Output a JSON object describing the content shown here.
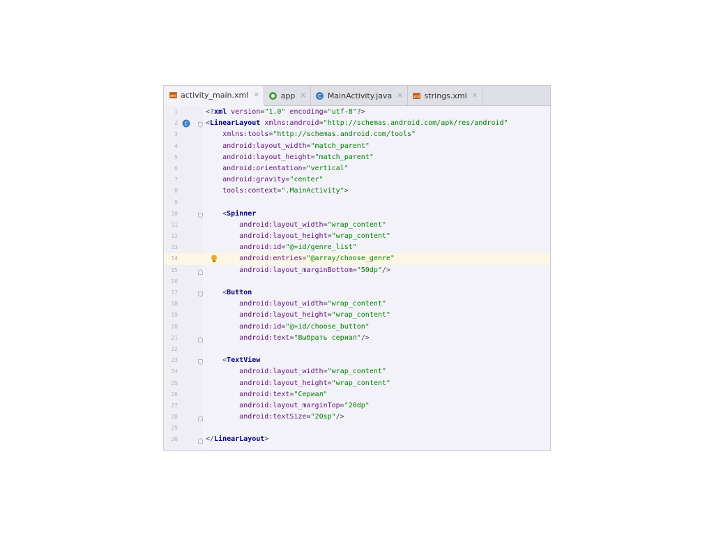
{
  "tabs": [
    {
      "label": "activity_main.xml",
      "icon": "xml-file-icon",
      "active": true
    },
    {
      "label": "app",
      "icon": "android-module-icon",
      "active": false
    },
    {
      "label": "MainActivity.java",
      "icon": "java-class-icon",
      "active": false
    },
    {
      "label": "strings.xml",
      "icon": "xml-file-icon",
      "active": false
    }
  ],
  "lines": [
    {
      "n": "1",
      "parts": [
        [
          "p",
          "<?"
        ],
        [
          "k",
          "xml "
        ],
        [
          "a",
          "version"
        ],
        [
          "p",
          "="
        ],
        [
          "v",
          "\"1.0\" "
        ],
        [
          "a",
          "encoding"
        ],
        [
          "p",
          "="
        ],
        [
          "v",
          "\"utf-8\""
        ],
        [
          "p",
          "?>"
        ]
      ]
    },
    {
      "n": "2",
      "marker": "c",
      "fold": "open",
      "parts": [
        [
          "p",
          "<"
        ],
        [
          "k",
          "LinearLayout "
        ],
        [
          "a",
          "xmlns:android"
        ],
        [
          "p",
          "="
        ],
        [
          "v",
          "\"http://schemas.android.com/apk/res/android\""
        ]
      ]
    },
    {
      "n": "3",
      "parts": [
        [
          "p",
          "    "
        ],
        [
          "a",
          "xmlns:tools"
        ],
        [
          "p",
          "="
        ],
        [
          "v",
          "\"http://schemas.android.com/tools\""
        ]
      ]
    },
    {
      "n": "4",
      "parts": [
        [
          "p",
          "    "
        ],
        [
          "a",
          "android:layout_width"
        ],
        [
          "p",
          "="
        ],
        [
          "v",
          "\"match_parent\""
        ]
      ]
    },
    {
      "n": "5",
      "parts": [
        [
          "p",
          "    "
        ],
        [
          "a",
          "android:layout_height"
        ],
        [
          "p",
          "="
        ],
        [
          "v",
          "\"match_parent\""
        ]
      ]
    },
    {
      "n": "6",
      "parts": [
        [
          "p",
          "    "
        ],
        [
          "a",
          "android:orientation"
        ],
        [
          "p",
          "="
        ],
        [
          "v",
          "\"vertical\""
        ]
      ]
    },
    {
      "n": "7",
      "parts": [
        [
          "p",
          "    "
        ],
        [
          "a",
          "android:gravity"
        ],
        [
          "p",
          "="
        ],
        [
          "v",
          "\"center\""
        ]
      ]
    },
    {
      "n": "8",
      "parts": [
        [
          "p",
          "    "
        ],
        [
          "a",
          "tools:context"
        ],
        [
          "p",
          "="
        ],
        [
          "v",
          "\".MainActivity\""
        ],
        [
          "p",
          ">"
        ]
      ]
    },
    {
      "n": "9",
      "parts": []
    },
    {
      "n": "10",
      "fold": "open",
      "parts": [
        [
          "p",
          "    <"
        ],
        [
          "k",
          "Spinner"
        ]
      ]
    },
    {
      "n": "11",
      "parts": [
        [
          "p",
          "        "
        ],
        [
          "a",
          "android:layout_width"
        ],
        [
          "p",
          "="
        ],
        [
          "v",
          "\"wrap_content\""
        ]
      ]
    },
    {
      "n": "12",
      "parts": [
        [
          "p",
          "        "
        ],
        [
          "a",
          "android:layout_height"
        ],
        [
          "p",
          "="
        ],
        [
          "v",
          "\"wrap_content\""
        ]
      ]
    },
    {
      "n": "13",
      "parts": [
        [
          "p",
          "        "
        ],
        [
          "a",
          "android:id"
        ],
        [
          "p",
          "="
        ],
        [
          "v",
          "\"@+id/genre_list\""
        ]
      ]
    },
    {
      "n": "14",
      "highlight": true,
      "bulb": true,
      "parts": [
        [
          "p",
          "        "
        ],
        [
          "a",
          "android:entries"
        ],
        [
          "p",
          "="
        ],
        [
          "v",
          "\"@array/choose_genre\""
        ]
      ]
    },
    {
      "n": "15",
      "fold": "close",
      "parts": [
        [
          "p",
          "        "
        ],
        [
          "a",
          "android:layout_marginBottom"
        ],
        [
          "p",
          "="
        ],
        [
          "v",
          "\"50dp\""
        ],
        [
          "p",
          "/>"
        ]
      ]
    },
    {
      "n": "16",
      "parts": []
    },
    {
      "n": "17",
      "fold": "open",
      "parts": [
        [
          "p",
          "    <"
        ],
        [
          "k",
          "Button"
        ]
      ]
    },
    {
      "n": "18",
      "parts": [
        [
          "p",
          "        "
        ],
        [
          "a",
          "android:layout_width"
        ],
        [
          "p",
          "="
        ],
        [
          "v",
          "\"wrap_content\""
        ]
      ]
    },
    {
      "n": "19",
      "parts": [
        [
          "p",
          "        "
        ],
        [
          "a",
          "android:layout_height"
        ],
        [
          "p",
          "="
        ],
        [
          "v",
          "\"wrap_content\""
        ]
      ]
    },
    {
      "n": "20",
      "parts": [
        [
          "p",
          "        "
        ],
        [
          "a",
          "android:id"
        ],
        [
          "p",
          "="
        ],
        [
          "v",
          "\"@+id/choose_button\""
        ]
      ]
    },
    {
      "n": "21",
      "fold": "close",
      "parts": [
        [
          "p",
          "        "
        ],
        [
          "a",
          "android:text"
        ],
        [
          "p",
          "="
        ],
        [
          "v",
          "\"Выбрать сериал\""
        ],
        [
          "p",
          "/>"
        ]
      ]
    },
    {
      "n": "22",
      "parts": []
    },
    {
      "n": "23",
      "fold": "open",
      "parts": [
        [
          "p",
          "    <"
        ],
        [
          "k",
          "TextView"
        ]
      ]
    },
    {
      "n": "24",
      "parts": [
        [
          "p",
          "        "
        ],
        [
          "a",
          "android:layout_width"
        ],
        [
          "p",
          "="
        ],
        [
          "v",
          "\"wrap_content\""
        ]
      ]
    },
    {
      "n": "25",
      "parts": [
        [
          "p",
          "        "
        ],
        [
          "a",
          "android:layout_height"
        ],
        [
          "p",
          "="
        ],
        [
          "v",
          "\"wrap_content\""
        ]
      ]
    },
    {
      "n": "26",
      "parts": [
        [
          "p",
          "        "
        ],
        [
          "a",
          "android:text"
        ],
        [
          "p",
          "="
        ],
        [
          "v",
          "\"Сериал\""
        ]
      ]
    },
    {
      "n": "27",
      "parts": [
        [
          "p",
          "        "
        ],
        [
          "a",
          "android:layout_marginTop"
        ],
        [
          "p",
          "="
        ],
        [
          "v",
          "\"20dp\""
        ]
      ]
    },
    {
      "n": "28",
      "fold": "close",
      "parts": [
        [
          "p",
          "        "
        ],
        [
          "a",
          "android:textSize"
        ],
        [
          "p",
          "="
        ],
        [
          "v",
          "\"20sp\""
        ],
        [
          "p",
          "/>"
        ]
      ]
    },
    {
      "n": "29",
      "parts": []
    },
    {
      "n": "30",
      "fold": "close",
      "parts": [
        [
          "p",
          "</"
        ],
        [
          "k",
          "LinearLayout"
        ],
        [
          "p",
          ">"
        ]
      ]
    }
  ],
  "colors": {
    "tag": "#000080",
    "attribute": "#660e7a",
    "value": "#008000",
    "highlight_line": "#fbf6e6",
    "bulb": "#e8a820",
    "class_marker": "#3b7fc4"
  }
}
